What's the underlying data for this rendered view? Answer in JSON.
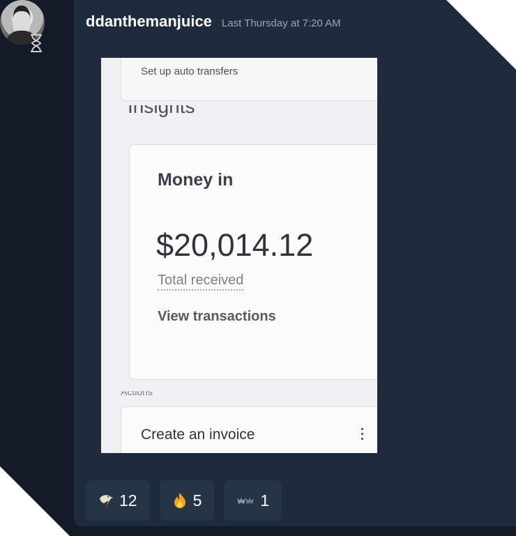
{
  "message": {
    "username": "ddanthemanjuice",
    "timestamp": "Last Thursday at 7:20 AM"
  },
  "attachment": {
    "top_card_label": "Set up auto transfers",
    "insights_fragment": "Insights",
    "money_card": {
      "title": "Money in",
      "amount": "$20,014.12",
      "caption": "Total received",
      "link": "View transactions"
    },
    "actions_fragment": "Actions",
    "invoice_card": {
      "label": "Create an invoice"
    }
  },
  "reactions": [
    {
      "icon": "eagle-emoji-icon",
      "count": "12"
    },
    {
      "icon": "fire-emoji-icon",
      "count": "5"
    },
    {
      "icon": "bats-emoji-icon",
      "count": "1"
    }
  ],
  "colors": {
    "backdrop": "#121b27",
    "panel": "#1d2b3c",
    "reaction_bg": "#263546",
    "timestamp": "#9aa6b4"
  }
}
